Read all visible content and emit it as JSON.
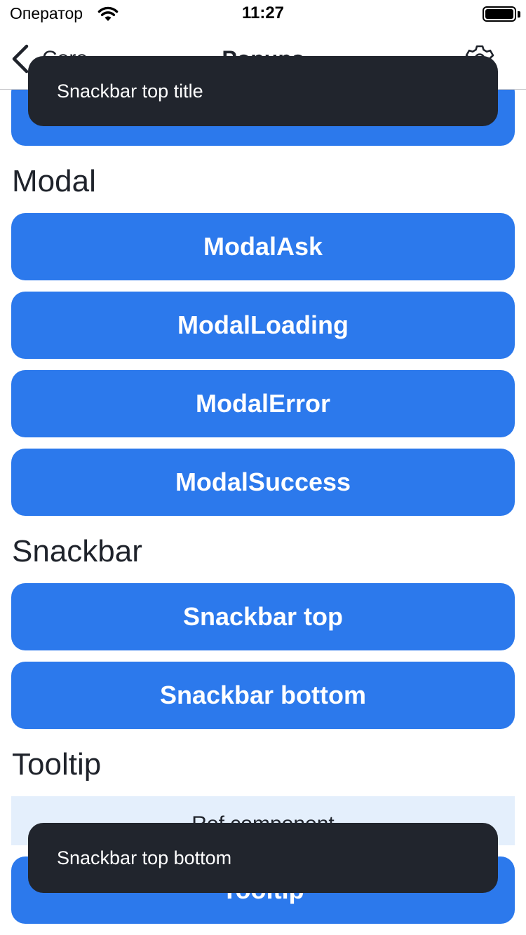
{
  "status_bar": {
    "carrier": "Оператор",
    "time": "11:27"
  },
  "nav": {
    "back_label": "Core",
    "title": "Popups"
  },
  "sections": {
    "modal_title": "Modal",
    "snackbar_title": "Snackbar",
    "tooltip_title": "Tooltip"
  },
  "buttons": {
    "modal_ask": "ModalAsk",
    "modal_loading": "ModalLoading",
    "modal_error": "ModalError",
    "modal_success": "ModalSuccess",
    "snackbar_top": "Snackbar top",
    "snackbar_bottom": "Snackbar bottom",
    "tooltip": "Tooltip"
  },
  "ref_component": "Ref component",
  "snackbars": {
    "top": "Snackbar top title",
    "bottom": "Snackbar top bottom"
  },
  "colors": {
    "accent": "#2c79ec",
    "snackbar_bg": "#21252d",
    "ref_bg": "#e4effc",
    "text": "#1f232b"
  },
  "icons": [
    "wifi-icon",
    "battery-icon",
    "back-chevron-icon",
    "gear-icon"
  ]
}
